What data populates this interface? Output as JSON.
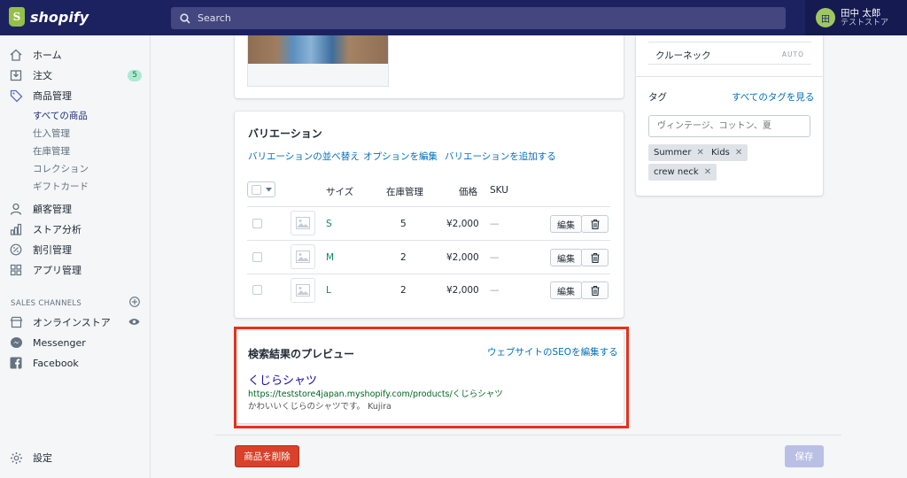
{
  "brand": {
    "name": "shopify"
  },
  "search": {
    "placeholder": "Search"
  },
  "user": {
    "initial": "田",
    "name": "田中 太郎",
    "store": "テストストア"
  },
  "sidebar": {
    "items": [
      {
        "label": "ホーム",
        "icon": "home-icon"
      },
      {
        "label": "注文",
        "icon": "orders-icon",
        "badge": "5"
      },
      {
        "label": "商品管理",
        "icon": "tag-icon"
      },
      {
        "label": "顧客管理",
        "icon": "customer-icon"
      },
      {
        "label": "ストア分析",
        "icon": "analytics-icon"
      },
      {
        "label": "割引管理",
        "icon": "discount-icon"
      },
      {
        "label": "アプリ管理",
        "icon": "apps-icon"
      }
    ],
    "sub_items": [
      "すべての商品",
      "仕入管理",
      "在庫管理",
      "コレクション",
      "ギフトカード"
    ],
    "sales_channels_label": "SALES CHANNELS",
    "channels": [
      {
        "label": "オンラインストア",
        "icon": "store-icon"
      },
      {
        "label": "Messenger",
        "icon": "messenger-icon"
      },
      {
        "label": "Facebook",
        "icon": "facebook-icon"
      }
    ],
    "settings_label": "設定"
  },
  "variants": {
    "title": "バリエーション",
    "actions": [
      "バリエーションの並べ替え",
      "オプションを編集",
      "バリエーションを追加する"
    ],
    "columns": {
      "size": "サイズ",
      "inventory": "在庫管理",
      "price": "価格",
      "sku": "SKU"
    },
    "rows": [
      {
        "size": "S",
        "inventory": "5",
        "price": "¥2,000",
        "sku": "—"
      },
      {
        "size": "M",
        "inventory": "2",
        "price": "¥2,000",
        "sku": "—"
      },
      {
        "size": "L",
        "inventory": "2",
        "price": "¥2,000",
        "sku": "—"
      }
    ],
    "edit_label": "編集"
  },
  "seo": {
    "title": "検索結果のプレビュー",
    "edit_link": "ウェブサイトのSEOを編集する",
    "page_title": "くじらシャツ",
    "url": "https://teststore4japan.myshopify.com/products/くじらシャツ",
    "description": "かわいいくじらのシャツです。 Kujira"
  },
  "right_panel": {
    "type_value": "クルーネック",
    "auto_label": "AUTO",
    "tags_title": "タグ",
    "tags_link": "すべてのタグを見る",
    "tags_placeholder": "ヴィンテージ、コットン、夏",
    "tags": [
      "Summer",
      "Kids",
      "crew neck"
    ]
  },
  "footer": {
    "delete_label": "商品を削除",
    "save_label": "保存"
  },
  "colors": {
    "topbar": "#1c2260",
    "accent": "#5c6ac4",
    "danger": "#d9412a",
    "highlight": "#e8301a"
  }
}
